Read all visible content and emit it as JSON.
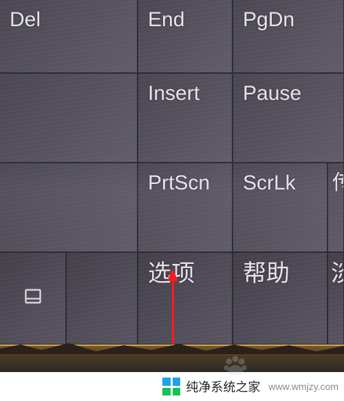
{
  "osk": {
    "row1": {
      "del": "Del",
      "end": "End",
      "pgdn": "PgDn"
    },
    "row2": {
      "insert": "Insert",
      "pause": "Pause"
    },
    "row3": {
      "prtscn": "PrtScn",
      "scrlk": "ScrLk",
      "partial": "传"
    },
    "row4": {
      "options": "选项",
      "help": "帮助",
      "fade_partial": "淡"
    }
  },
  "watermark": {
    "brand": "纯净系统之家",
    "url": "www.wmjzy.com"
  }
}
